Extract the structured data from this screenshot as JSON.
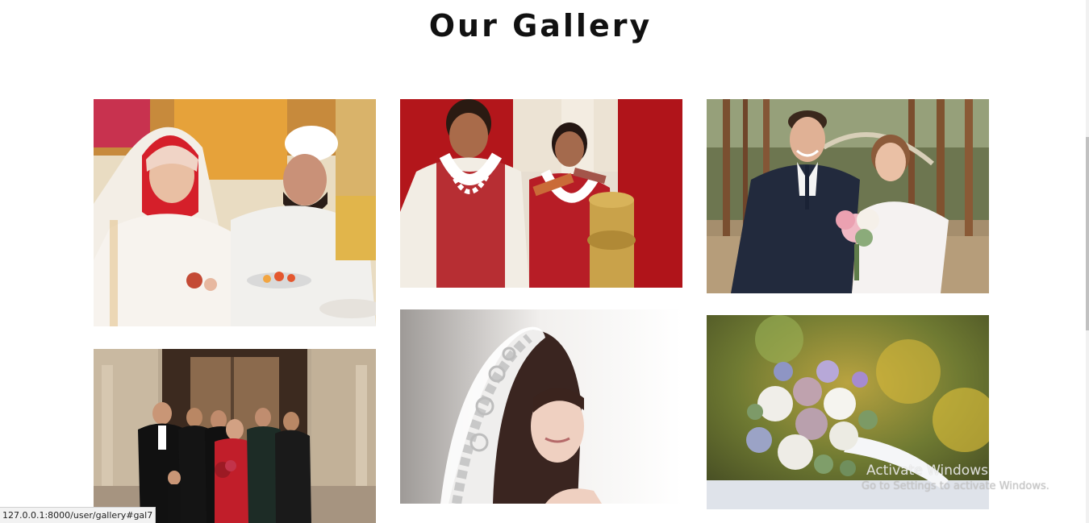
{
  "gallery": {
    "title": "Our Gallery",
    "images": [
      {
        "name": "gallery-image-1",
        "alt": "Bride in red hijab and groom in white kurta exchanging rings"
      },
      {
        "name": "gallery-image-2",
        "alt": "Indian couple in garlands during wedding ceremony"
      },
      {
        "name": "gallery-image-3",
        "alt": "Couple in forest with bouquet"
      },
      {
        "name": "gallery-image-4",
        "alt": "Wedding party group celebrating on steps"
      },
      {
        "name": "gallery-image-5",
        "alt": "Bride with lace veil"
      },
      {
        "name": "gallery-image-6",
        "alt": "Bridal bouquet of roses"
      }
    ]
  },
  "status_bar": {
    "url": "127.0.0.1:8000/user/gallery#gal7"
  },
  "os_watermark": {
    "line1": "Activate Windows",
    "line2": "Go to Settings to activate Windows."
  }
}
